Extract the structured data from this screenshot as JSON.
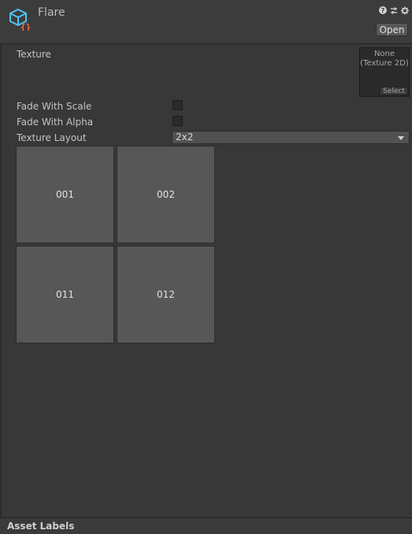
{
  "header": {
    "title": "Flare",
    "open_label": "Open",
    "icons": [
      "help-icon",
      "preset-icon",
      "gear-icon"
    ]
  },
  "texture": {
    "label": "Texture",
    "value_line1": "None",
    "value_line2": "(Texture 2D)",
    "select_label": "Select"
  },
  "fade_scale": {
    "label": "Fade With Scale",
    "checked": false
  },
  "fade_alpha": {
    "label": "Fade With Alpha",
    "checked": false
  },
  "layout": {
    "label": "Texture Layout",
    "value": "2x2"
  },
  "cells": [
    "001",
    "002",
    "011",
    "012"
  ],
  "footer": {
    "label": "Asset Labels"
  },
  "colors": {
    "icon_blue": "#4fc3f7",
    "icon_orange": "#ff6b3d"
  }
}
